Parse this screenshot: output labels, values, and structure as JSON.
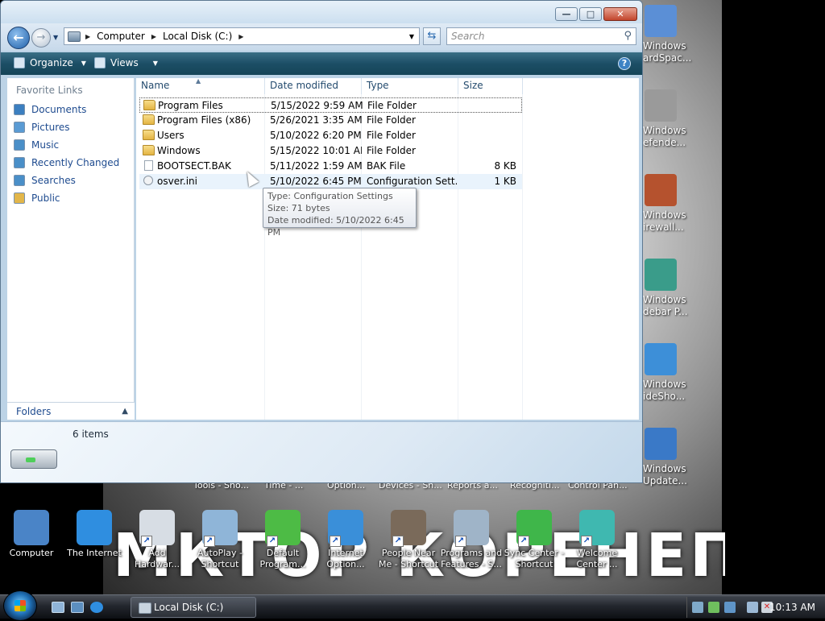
{
  "window": {
    "buttons": {
      "minimize": "—",
      "maximize": "□",
      "close": "✕"
    },
    "breadcrumb": [
      "Computer",
      "Local Disk (C:)"
    ],
    "search_placeholder": "Search",
    "toolbar": {
      "organize": "Organize",
      "views": "Views",
      "help": "?"
    }
  },
  "nav_pane": {
    "header": "Favorite Links",
    "items": [
      {
        "label": "Documents",
        "color": "#3c7fc0"
      },
      {
        "label": "Pictures",
        "color": "#5a9bd4"
      },
      {
        "label": "Music",
        "color": "#4a8fc8"
      },
      {
        "label": "Recently Changed",
        "color": "#4a8fc8"
      },
      {
        "label": "Searches",
        "color": "#4a8fc8"
      },
      {
        "label": "Public",
        "color": "#e2b64a"
      }
    ],
    "folders": "Folders"
  },
  "columns": [
    "Name",
    "Date modified",
    "Type",
    "Size"
  ],
  "files": [
    {
      "name": "Program Files",
      "date": "5/15/2022 9:59 AM",
      "type": "File Folder",
      "size": "",
      "icon": "folder"
    },
    {
      "name": "Program Files (x86)",
      "date": "5/26/2021 3:35 AM",
      "type": "File Folder",
      "size": "",
      "icon": "folder"
    },
    {
      "name": "Users",
      "date": "5/10/2022 6:20 PM",
      "type": "File Folder",
      "size": "",
      "icon": "folder"
    },
    {
      "name": "Windows",
      "date": "5/15/2022 10:01 AM",
      "type": "File Folder",
      "size": "",
      "icon": "folder"
    },
    {
      "name": "BOOTSECT.BAK",
      "date": "5/11/2022 1:59 AM",
      "type": "BAK File",
      "size": "8 KB",
      "icon": "document"
    },
    {
      "name": "osver.ini",
      "date": "5/10/2022 6:45 PM",
      "type": "Configuration Sett...",
      "size": "1 KB",
      "icon": "config"
    }
  ],
  "tooltip": {
    "type": "Type: Configuration Settings",
    "size": "Size: 71 bytes",
    "date": "Date modified: 5/10/2022 6:45 PM"
  },
  "status": {
    "item_count": "6 items"
  },
  "desktop_right": [
    {
      "label": "Windows\nardSpac...",
      "color": "#5b8fd6"
    },
    {
      "label": "Windows\nefende...",
      "color": "#9a9a9a"
    },
    {
      "label": "Windows\nirewall...",
      "color": "#b5522e"
    },
    {
      "label": "Windows\ndebar P...",
      "color": "#3a9c8a"
    },
    {
      "label": "Windows\nideSho...",
      "color": "#3d8fd8"
    },
    {
      "label": "Windows\nUpdate...",
      "color": "#3a79c7"
    }
  ],
  "desktop_cut": [
    "Tools - Sho...",
    "Time - ...",
    "Option...",
    "Devices - Sh...",
    "Reports a...",
    "Recogniti...",
    "Control Pan..."
  ],
  "desktop_bottom": [
    {
      "label": "Computer",
      "color": "#4a84c7",
      "shortcut": false
    },
    {
      "label": "The Internet",
      "color": "#2f8ee0",
      "shortcut": false
    },
    {
      "label": "Add Hardwar...",
      "color": "#d7dde4",
      "shortcut": true
    },
    {
      "label": "AutoPlay - Shortcut",
      "color": "#8fb5d8",
      "shortcut": true
    },
    {
      "label": "Default Program...",
      "color": "#4dbb45",
      "shortcut": true
    },
    {
      "label": "Internet Option...",
      "color": "#3a8fd9",
      "shortcut": true
    },
    {
      "label": "People Near Me - Shortcut",
      "color": "#7a6a5a",
      "shortcut": true
    },
    {
      "label": "Programs and Features - S...",
      "color": "#9fb4c8",
      "shortcut": true
    },
    {
      "label": "Sync Center - Shortcut",
      "color": "#3fb64a",
      "shortcut": true
    },
    {
      "label": "Welcome Center ...",
      "color": "#3fb8b0",
      "shortcut": true
    }
  ],
  "wallpaper_text": "МКТОР КОРЕНЕП",
  "taskbar": {
    "task": "Local Disk (C:)",
    "clock": "10:13 AM"
  }
}
